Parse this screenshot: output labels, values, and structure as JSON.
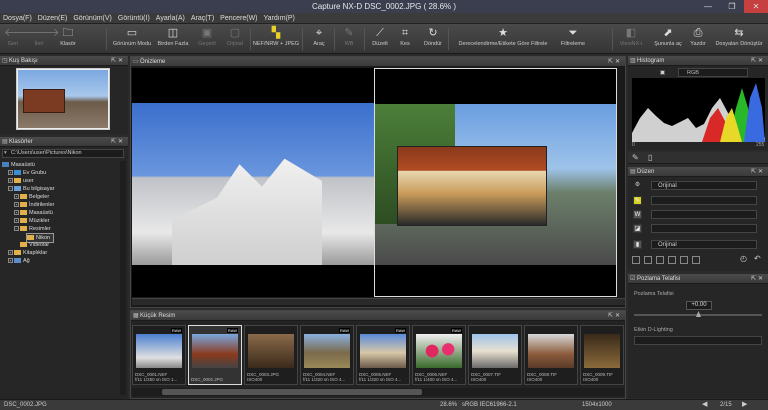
{
  "window": {
    "title": "Capture NX-D      DSC_0002.JPG ( 28.6% )",
    "minimize": "—",
    "maximize": "❐",
    "close": "✕"
  },
  "menu": [
    "Dosya(F)",
    "Düzen(E)",
    "Görünüm(V)",
    "Görüntü(I)",
    "Ayarla(A)",
    "Araç(T)",
    "Pencere(W)",
    "Yardım(P)"
  ],
  "toolbar": {
    "back": "Geri",
    "forward": "İleri",
    "folder": "Klasör",
    "view_mode": "Görünüm Modu",
    "multi": "Birden Fazla",
    "prev": "Geçerli",
    "orig": "Orjinal",
    "nef_jpeg": "NEF/NRW + JPEG",
    "tool": "Araç",
    "wb": "WB",
    "straighten": "Düzelt",
    "crop": "Kes",
    "rotate": "Döndür",
    "filter_label": "Derecelendirme/Etikete Göre Filtrele",
    "filter": "Filtreleme",
    "viewnx": "ViewNX-i",
    "open_with": "Şununla aç",
    "print": "Yazdır",
    "convert": "Dosyaları Dönüştür"
  },
  "bird_eye": {
    "title": "Kuş Bakışı"
  },
  "folders": {
    "title": "Klasörler",
    "path": "C:\\Users\\user\\Pictures\\Nikon",
    "items": [
      "Masaüstü",
      "Ev Grubu",
      "user",
      "Bu bilgisayar",
      "Belgeler",
      "İndirilenler",
      "Masaüstü",
      "Müzikler",
      "Resimler",
      "Nikon",
      "Videolar",
      "Kitaplıklar",
      "Ağ"
    ]
  },
  "viewer": {
    "title": "Önizleme"
  },
  "thumbnails": {
    "title": "Küçük Resim",
    "items": [
      {
        "cap1": "DSC_0001.NEF",
        "cap2": "f/11 1/250 sn ISO 1...",
        "raw": "RAW"
      },
      {
        "cap1": "DSC_0002.JPG",
        "cap2": "",
        "raw": "RAW"
      },
      {
        "cap1": "DSC_0003.JPG",
        "cap2": "ISO400",
        "raw": ""
      },
      {
        "cap1": "DSC_0004.NEF",
        "cap2": "f/11 1/320 sn ISO 4...",
        "raw": "RAW"
      },
      {
        "cap1": "DSC_0005.NEF",
        "cap2": "f/11 1/320 sn ISO 4...",
        "raw": "RAW"
      },
      {
        "cap1": "DSC_0006.NEF",
        "cap2": "f/11 1/400 sn ISO 4...",
        "raw": "RAW"
      },
      {
        "cap1": "DSC_0007.TIF",
        "cap2": "ISO400",
        "raw": ""
      },
      {
        "cap1": "DSC_0008.TIF",
        "cap2": "ISO400",
        "raw": ""
      },
      {
        "cap1": "DSC_0009.TIF",
        "cap2": "ISO400",
        "raw": ""
      }
    ]
  },
  "histogram": {
    "title": "Histogram",
    "channel": "RGB",
    "min": "0",
    "max": "255"
  },
  "adjust": {
    "title": "Düzen",
    "preset": "Orijinal",
    "preset2": "Orijinal"
  },
  "exposure": {
    "title": "Pozlama Telafisi",
    "label": "Pozlama Telafisi",
    "value": "+0.00",
    "dlighting": "Etkin D-Lighting"
  },
  "status": {
    "file": "DSC_0002.JPG",
    "zoom": "28.6%",
    "colorspace": "sRGB IEC61966-2.1",
    "size": "1504x1000",
    "page": "2/15"
  },
  "colors": {
    "accent": "#e0b04a",
    "bg": "#2b2b2b"
  }
}
